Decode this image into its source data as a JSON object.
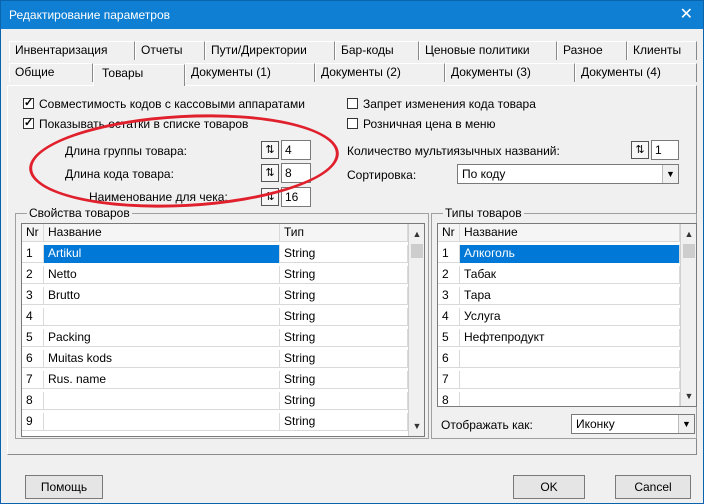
{
  "window": {
    "title": "Редактирование параметров",
    "close_glyph": "✕"
  },
  "tabs_row1": [
    {
      "label": "Инвентаризация"
    },
    {
      "label": "Отчеты"
    },
    {
      "label": "Пути/Директории"
    },
    {
      "label": "Бар-коды"
    },
    {
      "label": "Ценовые политики"
    },
    {
      "label": "Разное"
    },
    {
      "label": "Клиенты"
    }
  ],
  "tabs_row2": [
    {
      "label": "Общие"
    },
    {
      "label": "Товары"
    },
    {
      "label": "Документы (1)"
    },
    {
      "label": "Документы (2)"
    },
    {
      "label": "Документы (3)"
    },
    {
      "label": "Документы (4)"
    }
  ],
  "active_tab": "Товары",
  "checks": {
    "compat": {
      "label": "Совместимость кодов с кассовыми аппаратами",
      "checked": true
    },
    "show_stock": {
      "label": "Показывать остатки в списке товаров",
      "checked": true
    },
    "deny_code_change": {
      "label": "Запрет изменения кода товара",
      "checked": false
    },
    "retail_in_menu": {
      "label": "Розничная цена в меню",
      "checked": false
    }
  },
  "check_mark": "✓",
  "fields": {
    "group_len": {
      "label": "Длина группы товара:",
      "value": "4"
    },
    "code_len": {
      "label": "Длина кода товара:",
      "value": "8"
    },
    "receipt_name": {
      "label": "Наименование для чека:",
      "value": "16"
    },
    "multiname_count": {
      "label": "Количество мультиязычных названий:",
      "value": "1"
    },
    "sort": {
      "label": "Сортировка:",
      "value": "По коду"
    }
  },
  "spin_glyph": "⇅",
  "props": {
    "title": "Свойства товаров",
    "headers": {
      "nr": "Nr",
      "name": "Название",
      "type": "Тип"
    },
    "rows": [
      {
        "nr": "1",
        "name": "Artikul",
        "type": "String"
      },
      {
        "nr": "2",
        "name": "Netto",
        "type": "String"
      },
      {
        "nr": "3",
        "name": "Brutto",
        "type": "String"
      },
      {
        "nr": "4",
        "name": "",
        "type": "String"
      },
      {
        "nr": "5",
        "name": "Packing",
        "type": "String"
      },
      {
        "nr": "6",
        "name": "Muitas kods",
        "type": "String"
      },
      {
        "nr": "7",
        "name": "Rus. name",
        "type": "String"
      },
      {
        "nr": "8",
        "name": "",
        "type": "String"
      },
      {
        "nr": "9",
        "name": "",
        "type": "String"
      }
    ]
  },
  "types": {
    "title": "Типы товаров",
    "headers": {
      "nr": "Nr",
      "name": "Название"
    },
    "rows": [
      {
        "nr": "1",
        "name": "Алкоголь"
      },
      {
        "nr": "2",
        "name": "Табак"
      },
      {
        "nr": "3",
        "name": "Тара"
      },
      {
        "nr": "4",
        "name": "Услуга"
      },
      {
        "nr": "5",
        "name": "Нефтепродукт"
      },
      {
        "nr": "6",
        "name": ""
      },
      {
        "nr": "7",
        "name": ""
      },
      {
        "nr": "8",
        "name": ""
      }
    ],
    "display_label": "Отображать как:",
    "display_value": "Иконку"
  },
  "buttons": {
    "help": "Помощь",
    "ok": "OK",
    "cancel": "Cancel"
  },
  "glyphs": {
    "up": "▲",
    "down": "▼",
    "combo": "▼"
  }
}
